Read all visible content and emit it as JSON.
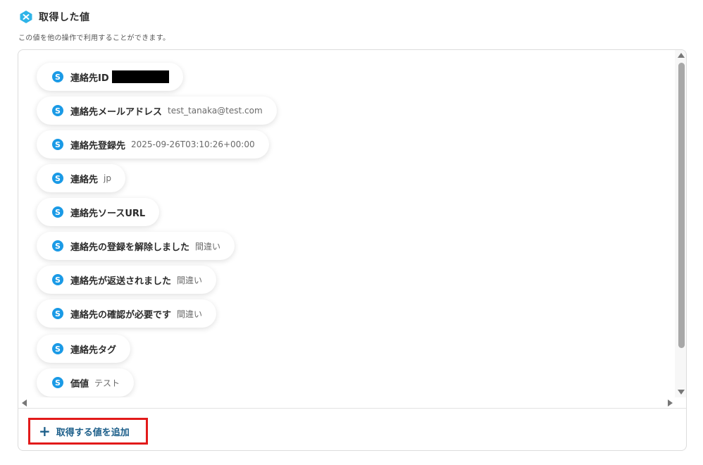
{
  "header": {
    "title": "取得した値",
    "subtitle": "この値を他の操作で利用することができます。"
  },
  "items": [
    {
      "label": "連絡先ID",
      "value": ""
    },
    {
      "label": "連絡先メールアドレス",
      "value": "test_tanaka@test.com"
    },
    {
      "label": "連絡先登録先",
      "value": "2025-09-26T03:10:26+00:00"
    },
    {
      "label": "連絡先",
      "value": "jp"
    },
    {
      "label": "連絡先ソースURL",
      "value": ""
    },
    {
      "label": "連絡先の登録を解除しました",
      "value": "間違い"
    },
    {
      "label": "連絡先が返送されました",
      "value": "間違い"
    },
    {
      "label": "連絡先の確認が必要です",
      "value": "間違い"
    },
    {
      "label": "連絡先タグ",
      "value": ""
    },
    {
      "label": "価値",
      "value": "テスト"
    }
  ],
  "icons": {
    "item_icon_letter": "S",
    "item_icon_color": "#1a9ae6",
    "header_icon_color": "#2fb4e8"
  },
  "footer": {
    "add_label": "取得する値を追加"
  }
}
